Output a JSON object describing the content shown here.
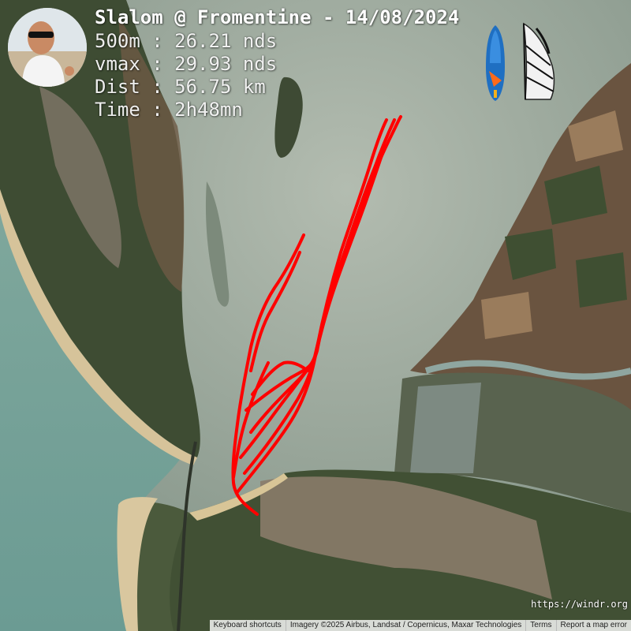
{
  "overlay": {
    "title": "Slalom @ Fromentine - 14/08/2024",
    "stats": [
      "500m : 26.21 nds",
      "vmax : 29.93 nds",
      "Dist : 56.75 km",
      "Time : 2h48mn"
    ],
    "site_url": "https://windr.org"
  },
  "map_footer": {
    "keyboard_shortcuts": "Keyboard shortcuts",
    "imagery": "Imagery ©2025 Airbus, Landsat / Copernicus, Maxar Technologies",
    "terms": "Terms",
    "report": "Report a map error"
  },
  "icons": {
    "avatar": "rider-avatar",
    "board": "windsurf-board-icon",
    "sail": "windsurf-sail-icon"
  },
  "colors": {
    "track": "#ff0000",
    "sea": "#8fa39a",
    "open_sea": "#7aa8a0",
    "land_forest": "#3c4a30",
    "fields": "#7a5a3e",
    "sand": "#d9c49a",
    "town": "#8a7a6a"
  }
}
